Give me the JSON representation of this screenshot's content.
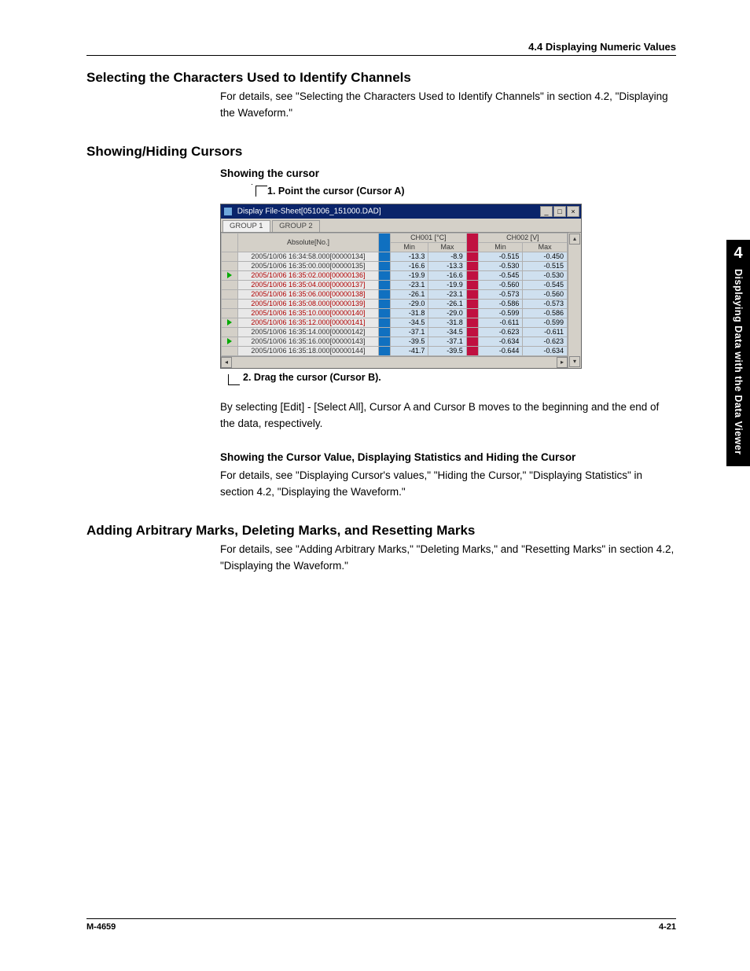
{
  "header_section": "4.4  Displaying Numeric Values",
  "side_tab": {
    "chapter": "4",
    "title": "Displaying Data with the Data Viewer"
  },
  "footer": {
    "left": "M-4659",
    "right": "4-21"
  },
  "s1": {
    "heading": "Selecting the Characters Used to Identify Channels",
    "body": "For details, see \"Selecting the Characters Used to Identify Channels\" in section 4.2, \"Displaying the Waveform.\""
  },
  "s2": {
    "heading": "Showing/Hiding Cursors",
    "sub": "Showing the cursor",
    "call1": "1. Point the cursor (Cursor A)",
    "call2": "2. Drag the cursor (Cursor B).",
    "after_img": "By selecting [Edit] - [Select All], Cursor A and Cursor B moves to the beginning and the end of the data, respectively.",
    "sub2": "Showing the Cursor Value, Displaying Statistics and Hiding the Cursor",
    "body2": "For details, see \"Displaying Cursor's values,\" \"Hiding the Cursor,\" \"Displaying Statistics\" in section 4.2, \"Displaying the Waveform.\""
  },
  "s3": {
    "heading": "Adding Arbitrary Marks, Deleting Marks, and Resetting Marks",
    "body": "For details, see \"Adding Arbitrary Marks,\" \"Deleting Marks,\" and \"Resetting Marks\" in section 4.2, \"Displaying the Waveform.\""
  },
  "win": {
    "title": "Display File-Sheet[051006_151000.DAD]",
    "tab1": "GROUP 1",
    "tab2": "GROUP 2",
    "hdr_abs": "Absolute[No.]",
    "ch1": "CH001 [°C]",
    "ch2": "CH002 [V]",
    "min": "Min",
    "max": "Max",
    "rows": [
      {
        "mark": "",
        "red": false,
        "ts": "2005/10/06 16:34:58.000[00000134]",
        "a": "-13.3",
        "b": "-8.9",
        "c": "-0.515",
        "d": "-0.450"
      },
      {
        "mark": "",
        "red": false,
        "ts": "2005/10/06 16:35:00.000[00000135]",
        "a": "-16.6",
        "b": "-13.3",
        "c": "-0.530",
        "d": "-0.515"
      },
      {
        "mark": "g",
        "red": true,
        "ts": "2005/10/06 16:35:02.000[00000136]",
        "a": "-19.9",
        "b": "-16.6",
        "c": "-0.545",
        "d": "-0.530"
      },
      {
        "mark": "",
        "red": true,
        "ts": "2005/10/06 16:35:04.000[00000137]",
        "a": "-23.1",
        "b": "-19.9",
        "c": "-0.560",
        "d": "-0.545"
      },
      {
        "mark": "",
        "red": true,
        "ts": "2005/10/06 16:35:06.000[00000138]",
        "a": "-26.1",
        "b": "-23.1",
        "c": "-0.573",
        "d": "-0.560"
      },
      {
        "mark": "",
        "red": true,
        "ts": "2005/10/06 16:35:08.000[00000139]",
        "a": "-29.0",
        "b": "-26.1",
        "c": "-0.586",
        "d": "-0.573"
      },
      {
        "mark": "",
        "red": true,
        "ts": "2005/10/06 16:35:10.000[00000140]",
        "a": "-31.8",
        "b": "-29.0",
        "c": "-0.599",
        "d": "-0.586"
      },
      {
        "mark": "g",
        "red": true,
        "ts": "2005/10/06 16:35:12.000[00000141]",
        "a": "-34.5",
        "b": "-31.8",
        "c": "-0.611",
        "d": "-0.599"
      },
      {
        "mark": "",
        "red": false,
        "ts": "2005/10/06 16:35:14.000[00000142]",
        "a": "-37.1",
        "b": "-34.5",
        "c": "-0.623",
        "d": "-0.611"
      },
      {
        "mark": "g",
        "red": false,
        "ts": "2005/10/06 16:35:16.000[00000143]",
        "a": "-39.5",
        "b": "-37.1",
        "c": "-0.634",
        "d": "-0.623"
      },
      {
        "mark": "",
        "red": false,
        "ts": "2005/10/06 16:35:18.000[00000144]",
        "a": "-41.7",
        "b": "-39.5",
        "c": "-0.644",
        "d": "-0.634"
      }
    ]
  }
}
